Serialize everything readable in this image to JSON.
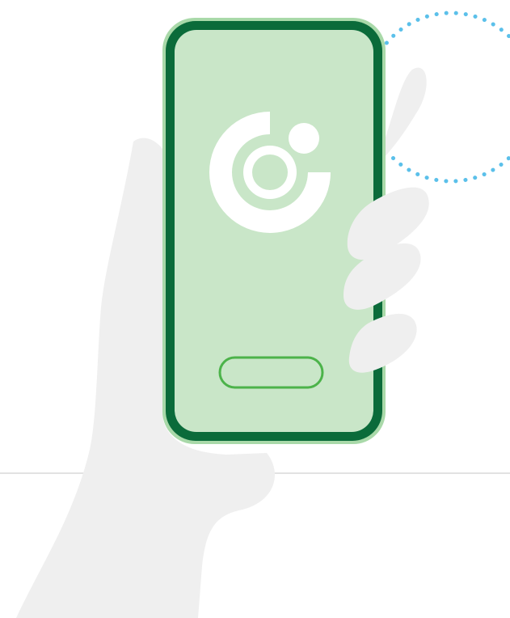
{
  "illustration": {
    "subject": "hand-holding-phone",
    "icon": "app-logo-icon",
    "colors": {
      "background": "#ffffff",
      "hand": "#efefef",
      "phone_frame": "#0b6b3a",
      "phone_outer_glow": "#a9d9a9",
      "phone_screen": "#c9e6c8",
      "logo": "#ffffff",
      "logo_faded": "#e9f5e9",
      "home_button_outline": "#4cb34a",
      "dotted_circle": "#5bc0ea",
      "floor_line": "#d9d9d9"
    }
  }
}
